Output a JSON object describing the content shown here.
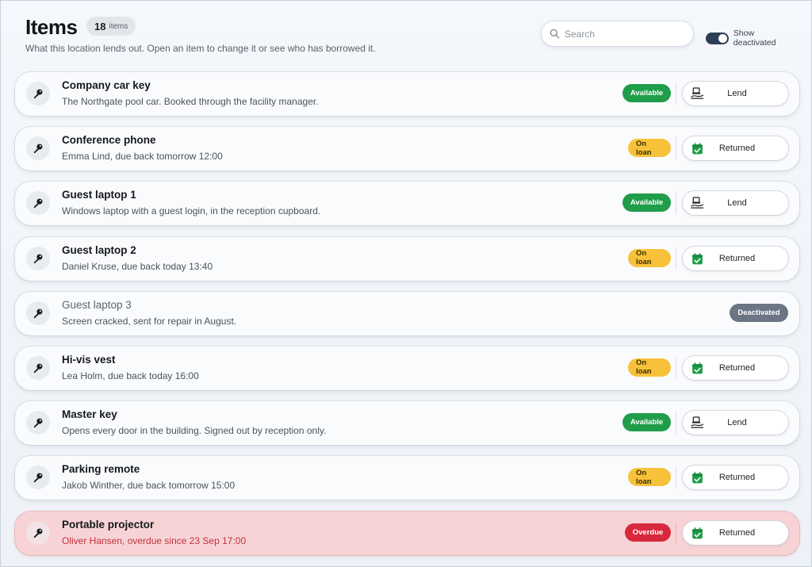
{
  "header": {
    "title": "Items",
    "count_number": "18",
    "count_unit": "items",
    "subtitle": "What this location lends out. Open an item to change it or see who has borrowed it."
  },
  "search": {
    "placeholder": "Search",
    "value": ""
  },
  "toggle": {
    "label": "Show deactivated",
    "on": true
  },
  "colors": {
    "available": "#1f9d4a",
    "on_loan": "#f7c23a",
    "overdue": "#d8293c",
    "deactivated": "#6b7584",
    "overdue_row": "#f8d3d6"
  },
  "items": [
    {
      "name": "Company car key",
      "description": "The Northgate pool car. Booked through the facility manager.",
      "status": "Available",
      "action": "Lend",
      "icon": "key-icon",
      "action_icon": "hand-lend-icon"
    },
    {
      "name": "Conference phone",
      "description": "Emma Lind, due back tomorrow 12:00",
      "status": "On loan",
      "action": "Returned",
      "icon": "key-icon",
      "action_icon": "calendar-check-icon"
    },
    {
      "name": "Guest laptop 1",
      "description": "Windows laptop with a guest login, in the reception cupboard.",
      "status": "Available",
      "action": "Lend",
      "icon": "key-icon",
      "action_icon": "hand-lend-icon"
    },
    {
      "name": "Guest laptop 2",
      "description": "Daniel Kruse, due back today 13:40",
      "status": "On loan",
      "action": "Returned",
      "icon": "key-icon",
      "action_icon": "calendar-check-icon"
    },
    {
      "name": "Guest laptop 3",
      "description": "Screen cracked, sent for repair in August.",
      "status": "Deactivated",
      "action": "",
      "icon": "key-icon",
      "action_icon": ""
    },
    {
      "name": "Hi-vis vest",
      "description": "Lea Holm, due back today 16:00",
      "status": "On loan",
      "action": "Returned",
      "icon": "key-icon",
      "action_icon": "calendar-check-icon"
    },
    {
      "name": "Master key",
      "description": "Opens every door in the building. Signed out by reception only.",
      "status": "Available",
      "action": "Lend",
      "icon": "key-icon",
      "action_icon": "hand-lend-icon"
    },
    {
      "name": "Parking remote",
      "description": "Jakob Winther, due back tomorrow 15:00",
      "status": "On loan",
      "action": "Returned",
      "icon": "key-icon",
      "action_icon": "calendar-check-icon"
    },
    {
      "name": "Portable projector",
      "description": "Oliver Hansen, overdue since 23 Sep 17:00",
      "status": "Overdue",
      "action": "Returned",
      "icon": "key-icon",
      "action_icon": "calendar-check-icon"
    }
  ]
}
